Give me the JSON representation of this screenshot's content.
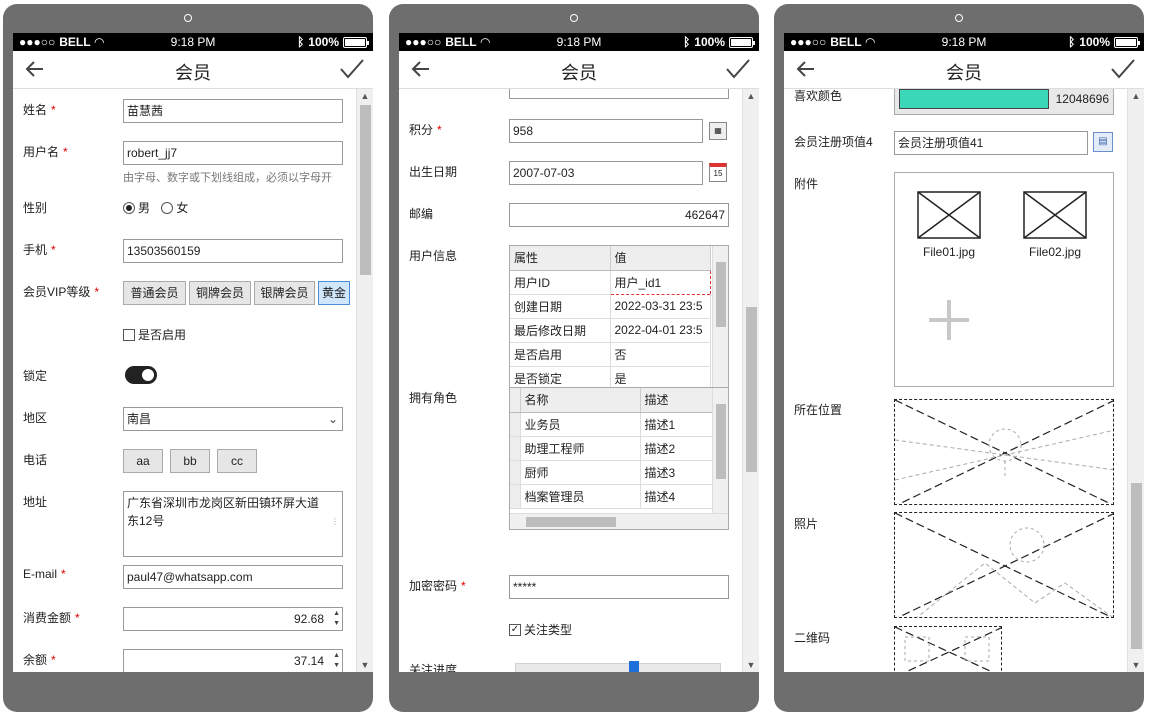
{
  "status": {
    "carrier": "BELL",
    "time": "9:18 PM",
    "battery": "100%"
  },
  "title": "会员",
  "screen1": {
    "name_label": "姓名",
    "name_value": "苗慧茜",
    "username_label": "用户名",
    "username_value": "robert_jj7",
    "username_hint": "由字母、数字或下划线组成，必须以字母开",
    "gender_label": "性别",
    "gender_options": [
      "男",
      "女"
    ],
    "gender_selected": "男",
    "phone_label": "手机",
    "phone_value": "13503560159",
    "vip_label": "会员VIP等级",
    "vip_options": [
      "普通会员",
      "铜牌会员",
      "银牌会员",
      "黄金"
    ],
    "enabled_label": "是否启用",
    "lock_label": "锁定",
    "region_label": "地区",
    "region_value": "南昌",
    "tel_label": "电话",
    "tel_options": [
      "aa",
      "bb",
      "cc"
    ],
    "address_label": "地址",
    "address_value": "广东省深圳市龙岗区新田镇环屏大道东12号",
    "email_label": "E-mail",
    "email_value": "paul47@whatsapp.com",
    "spend_label": "消费金额",
    "spend_value": "92.68",
    "balance_label": "余额",
    "balance_value": "37.14"
  },
  "screen2": {
    "points_label": "积分",
    "points_value": "958",
    "birth_label": "出生日期",
    "birth_value": "2007-07-03",
    "zip_label": "邮编",
    "zip_value": "462647",
    "userinfo_label": "用户信息",
    "userinfo_headers": [
      "属性",
      "值"
    ],
    "userinfo_rows": [
      [
        "用户ID",
        "用户_id1"
      ],
      [
        "创建日期",
        "2022-03-31 23:5"
      ],
      [
        "最后修改日期",
        "2022-04-01 23:5"
      ],
      [
        "是否启用",
        "否"
      ],
      [
        "是否锁定",
        "是"
      ]
    ],
    "roles_label": "拥有角色",
    "roles_headers": [
      "名称",
      "描述"
    ],
    "roles_rows": [
      [
        "业务员",
        "描述1"
      ],
      [
        "助理工程师",
        "描述2"
      ],
      [
        "厨师",
        "描述3"
      ],
      [
        "档案管理员",
        "描述4"
      ]
    ],
    "password_label": "加密密码",
    "password_value": "*****",
    "follow_type_label": "关注类型",
    "progress_label": "关注进度",
    "progress_fraction": 0.58
  },
  "screen3": {
    "color_label": "喜欢颜色",
    "color_value": "12048696",
    "color_swatch": "#3ad8b8",
    "reg_label": "会员注册项值4",
    "reg_value": "会员注册项值41",
    "attach_label": "附件",
    "files": [
      "File01.jpg",
      "File02.jpg"
    ],
    "location_label": "所在位置",
    "photo_label": "照片",
    "qr_label": "二维码"
  }
}
